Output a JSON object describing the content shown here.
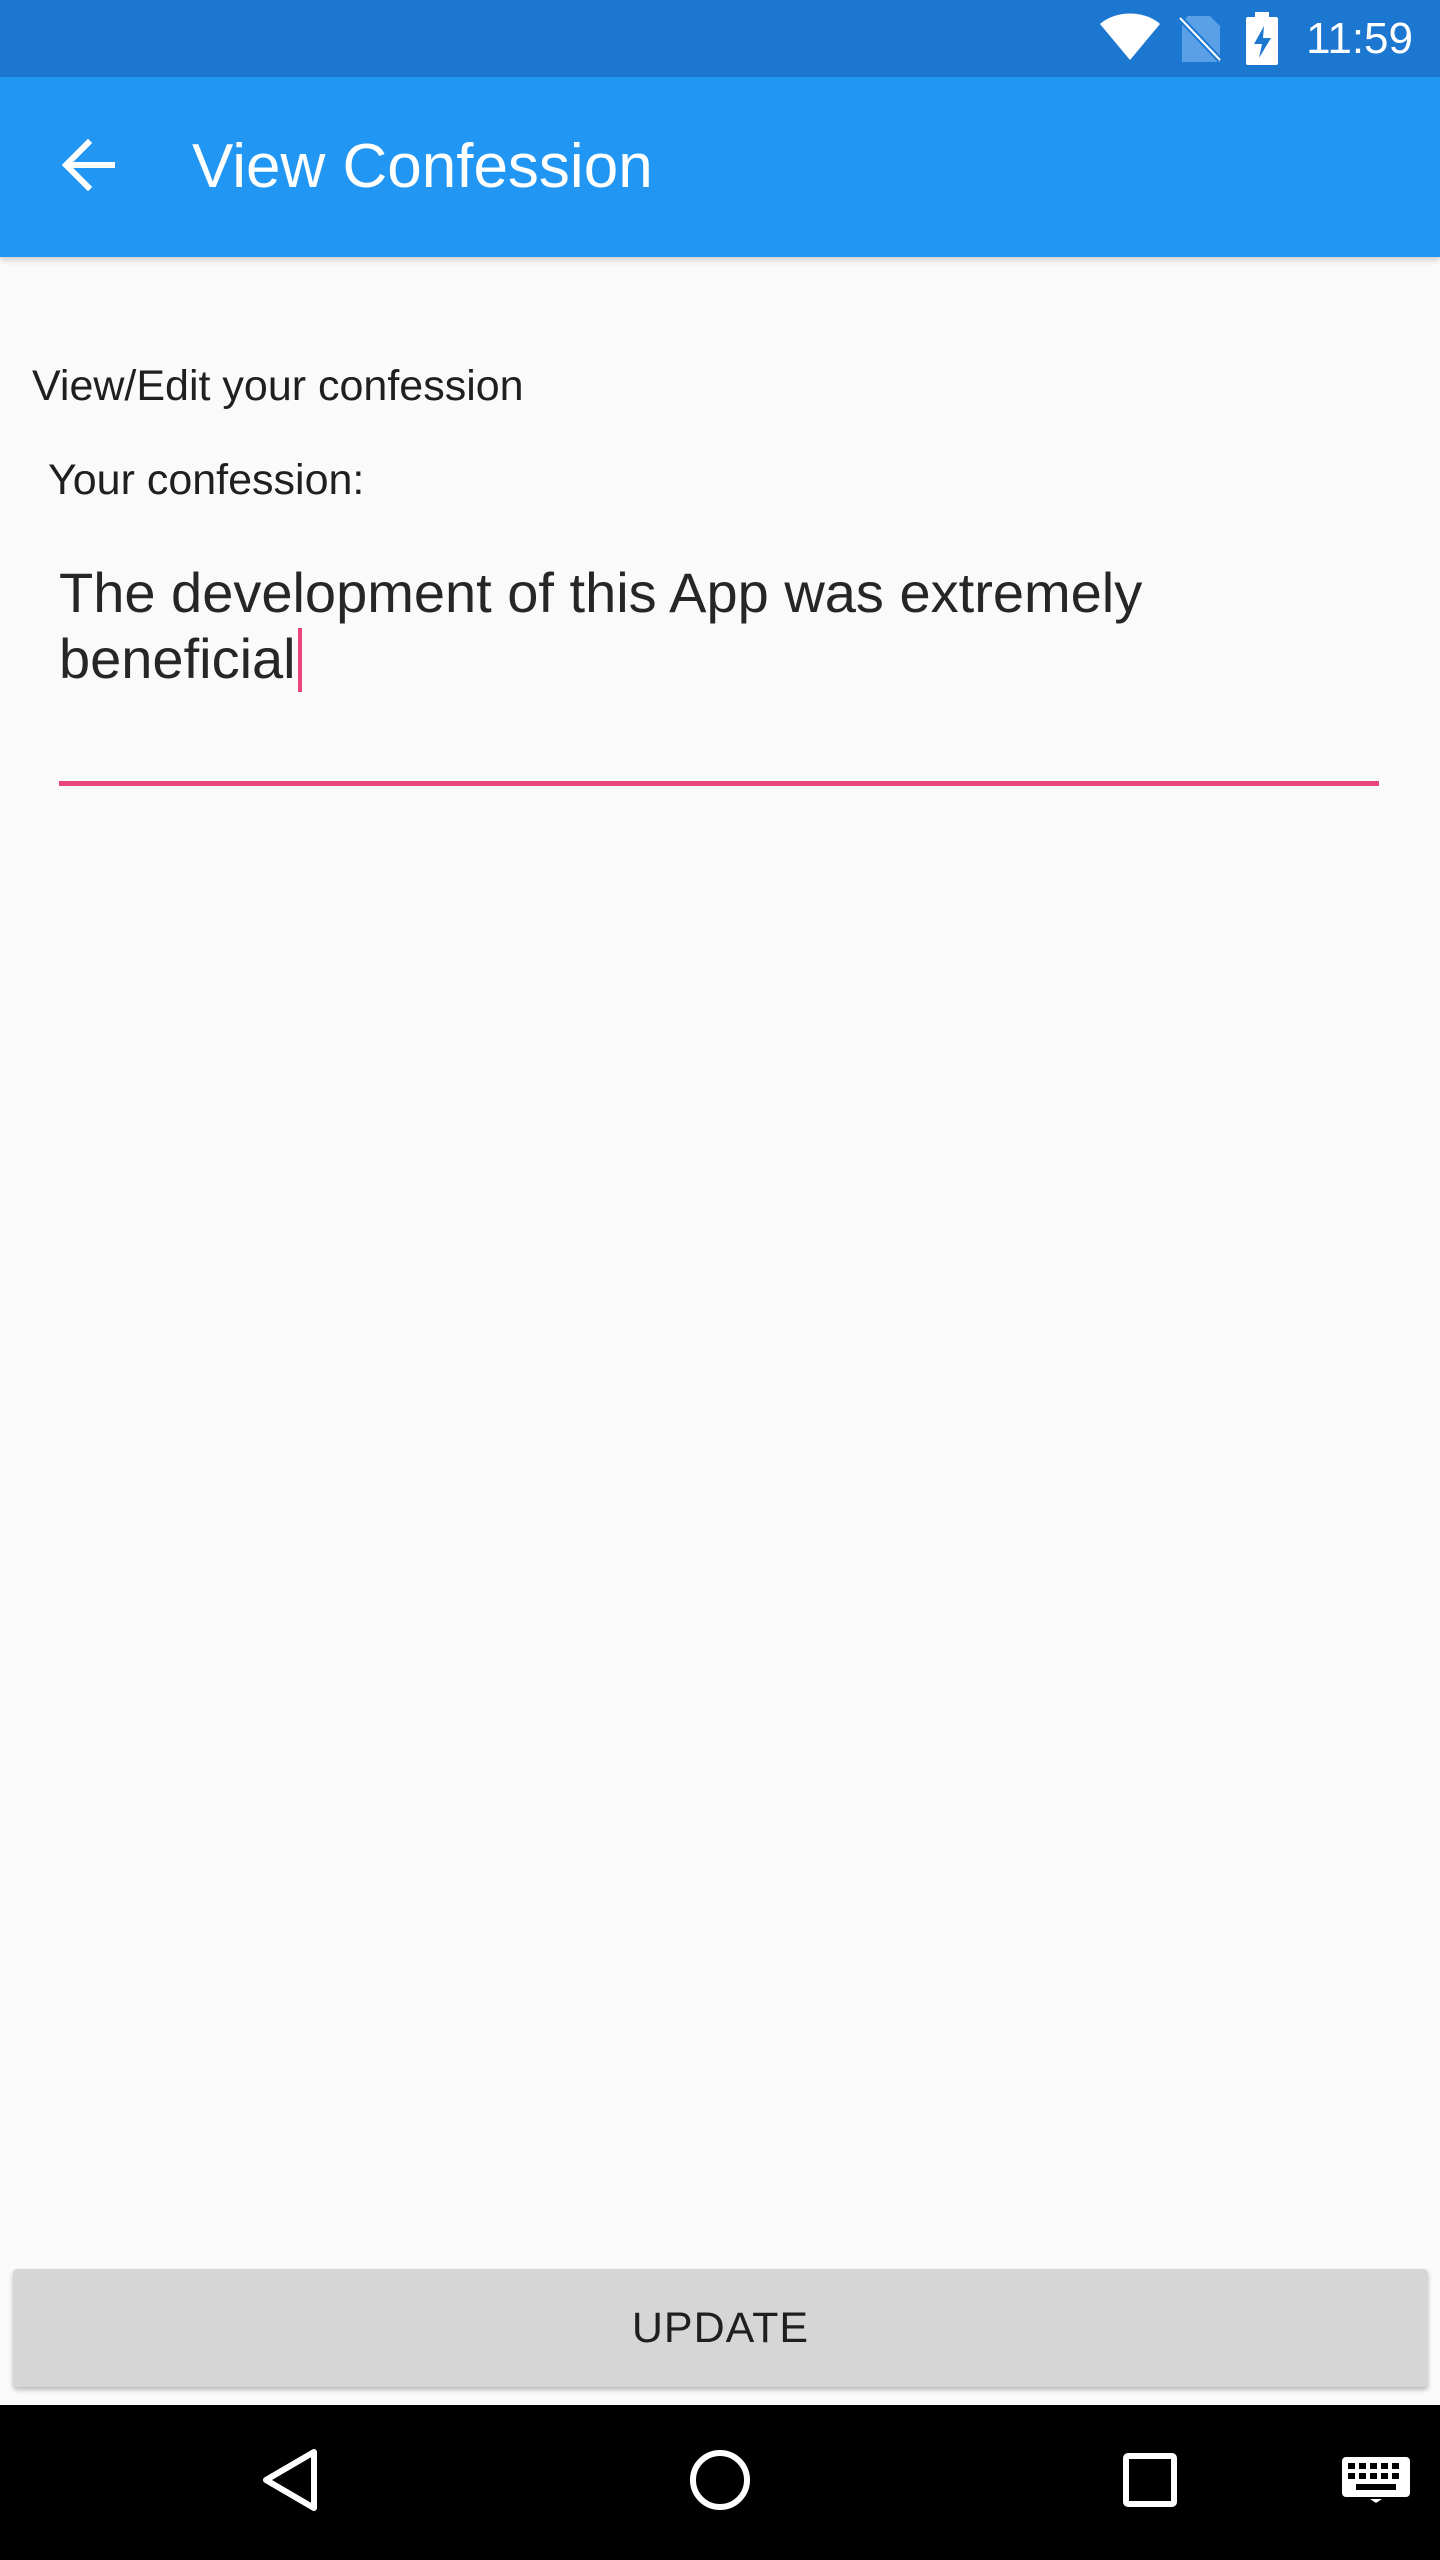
{
  "status_bar": {
    "time": "11:59",
    "icons": [
      "wifi-icon",
      "no-sim-icon",
      "battery-charging-icon"
    ],
    "background_color": "#1c77d1"
  },
  "app_bar": {
    "title": "View Confession",
    "back_icon": "arrow-back-icon",
    "background_color": "#2196f3"
  },
  "content": {
    "heading": "View/Edit your confession",
    "field_label": "Your confession:",
    "confession_value": "The development of this App was extremely\nbeneficial",
    "accent_color": "#e8467c"
  },
  "actions": {
    "update_label": "UPDATE"
  },
  "nav_bar": {
    "buttons": [
      "back-triangle-icon",
      "home-circle-icon",
      "recents-square-icon",
      "keyboard-icon"
    ]
  }
}
